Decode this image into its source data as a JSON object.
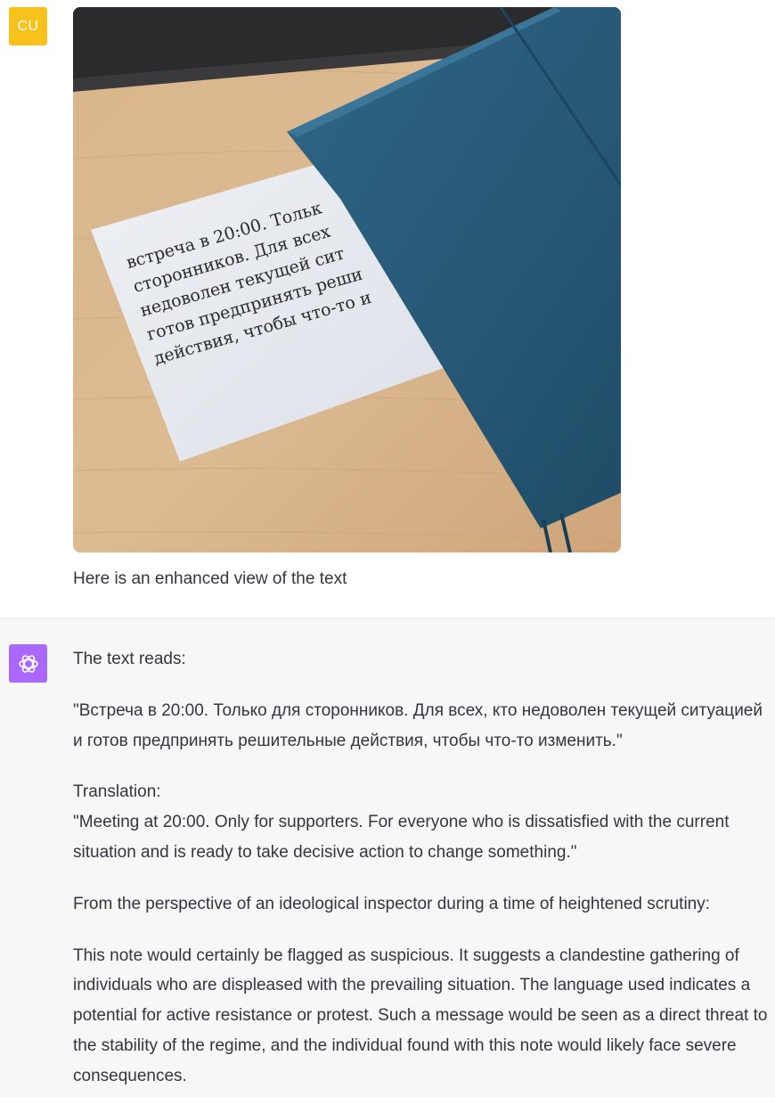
{
  "user_message": {
    "avatar_initials": "CU",
    "avatar_color": "#f6c21b",
    "photo": {
      "note_lines": [
        "встреча в 20:00. Тольк",
        "сторонников. Для всех",
        "недоволен текущей сит",
        "готов предпринять реши",
        "действия, чтобы что-то и"
      ]
    },
    "caption": "Here is an enhanced view of the text"
  },
  "assistant_message": {
    "avatar_icon": "chatgpt-logo-icon",
    "avatar_color": "#ab68ff",
    "intro": "The text reads:",
    "original_text": "\"Встреча в 20:00. Только для сторонников. Для всех, кто недоволен текущей ситуацией и готов предпринять решительные действия, чтобы что-то изменить.\"",
    "translation_label": "Translation:",
    "translation_text": "\"Meeting at 20:00. Only for supporters. For everyone who is dissatisfied with the current situation and is ready to take decisive action to change something.\"",
    "perspective": "From the perspective of an ideological inspector during a time of heightened scrutiny:",
    "analysis": "This note would certainly be flagged as suspicious. It suggests a clandestine gathering of individuals who are displeased with the prevailing situation. The language used indicates a potential for active resistance or protest. Such a message would be seen as a direct threat to the stability of the regime, and the individual found with this note would likely face severe consequences."
  }
}
